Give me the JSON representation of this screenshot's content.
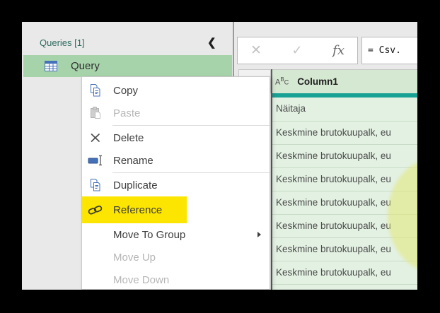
{
  "queries_pane": {
    "title": "Queries [1]",
    "collapse_glyph": "❮",
    "items": [
      {
        "label": "Query",
        "selected": true,
        "icon": "table-icon"
      }
    ]
  },
  "context_menu": {
    "items": [
      {
        "label": "Copy",
        "icon": "copy-icon",
        "state": "enabled"
      },
      {
        "label": "Paste",
        "icon": "paste-icon",
        "state": "disabled"
      },
      {
        "type": "separator"
      },
      {
        "label": "Delete",
        "icon": "delete-icon",
        "state": "enabled"
      },
      {
        "label": "Rename",
        "icon": "rename-icon",
        "state": "enabled"
      },
      {
        "type": "separator"
      },
      {
        "label": "Duplicate",
        "icon": "duplicate-icon",
        "state": "enabled"
      },
      {
        "label": "Reference",
        "icon": "reference-icon",
        "state": "enabled",
        "highlighted": true
      },
      {
        "label": "Move To Group",
        "state": "enabled",
        "submenu": true
      },
      {
        "label": "Move Up",
        "state": "disabled"
      },
      {
        "label": "Move Down",
        "state": "disabled"
      }
    ]
  },
  "formula_bar": {
    "cancel_glyph": "✕",
    "confirm_glyph": "✓",
    "fx_label": "fx",
    "formula_text": "= Csv."
  },
  "data_table": {
    "column1": {
      "type_icon": {
        "a": "A",
        "b": "B",
        "c": "C"
      },
      "label": "Column1"
    },
    "rows": [
      "Näitaja",
      "Keskmine brutokuupalk, eu",
      "Keskmine brutokuupalk, eu",
      "Keskmine brutokuupalk, eu",
      "Keskmine brutokuupalk, eu",
      "Keskmine brutokuupalk, eu",
      "Keskmine brutokuupalk, eu",
      "Keskmine brutokuupalk, eu",
      ""
    ]
  },
  "colors": {
    "selection_green": "#a7d3ab",
    "header_green": "#d5e8d2",
    "row_green": "#e3f1e2",
    "quality_bar_teal": "#18a195",
    "menu_highlight_yellow": "#fce500",
    "pane_title_green": "#2e6b5e"
  }
}
